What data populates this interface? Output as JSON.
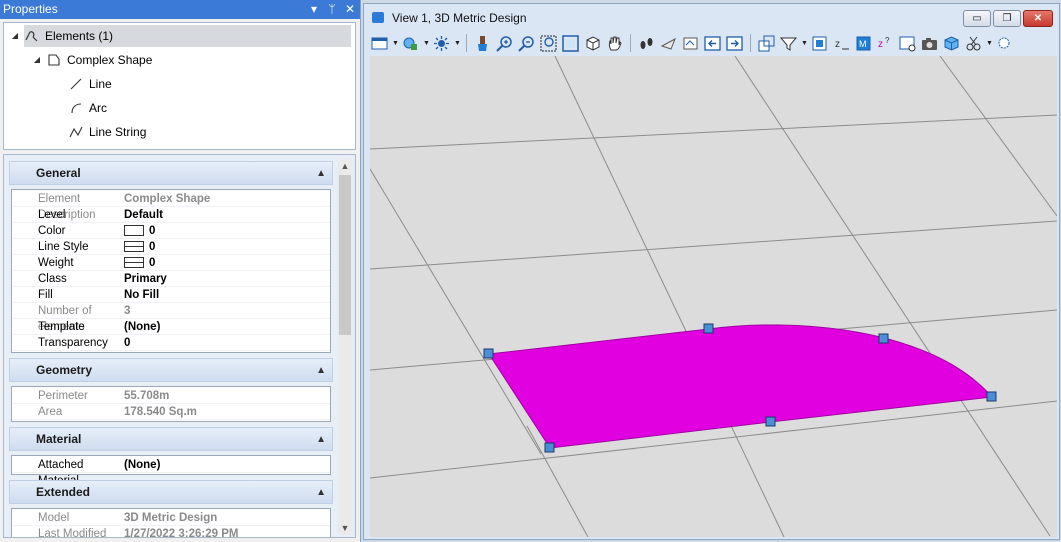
{
  "properties": {
    "title": "Properties",
    "title_buttons": [
      "▾",
      "ᛘ",
      "✕"
    ],
    "tree": [
      {
        "label": "Elements (1)",
        "icon": "elements-icon",
        "expander": "◢",
        "selected": true
      },
      {
        "label": "Complex Shape",
        "icon": "complex-shape-icon",
        "expander": "◢"
      },
      {
        "label": "Line",
        "icon": "line-icon"
      },
      {
        "label": "Arc",
        "icon": "arc-icon"
      },
      {
        "label": "Line String",
        "icon": "line-string-icon"
      }
    ],
    "sections": {
      "general": {
        "title": "General",
        "rows": [
          {
            "label": "Element Description",
            "value": "Complex Shape",
            "readonly": true
          },
          {
            "label": "Level",
            "value": "Default"
          },
          {
            "label": "Color",
            "value": "0",
            "swatch": "color"
          },
          {
            "label": "Line Style",
            "value": "0",
            "swatch": "lines"
          },
          {
            "label": "Weight",
            "value": "0",
            "swatch": "lines"
          },
          {
            "label": "Class",
            "value": "Primary"
          },
          {
            "label": "Fill",
            "value": "No Fill"
          },
          {
            "label": "Number of elements",
            "value": "3",
            "readonly": true
          },
          {
            "label": "Template",
            "value": "(None)"
          },
          {
            "label": "Transparency",
            "value": "0"
          }
        ]
      },
      "geometry": {
        "title": "Geometry",
        "rows": [
          {
            "label": "Perimeter",
            "value": "55.708m",
            "readonly": true
          },
          {
            "label": "Area",
            "value": "178.540 Sq.m",
            "readonly": true
          }
        ]
      },
      "material": {
        "title": "Material",
        "rows": [
          {
            "label": "Attached Material",
            "value": "(None)"
          }
        ]
      },
      "extended": {
        "title": "Extended",
        "rows": [
          {
            "label": "Model",
            "value": "3D Metric Design",
            "readonly": true
          },
          {
            "label": "Last Modified",
            "value": "1/27/2022 3:26:29 PM",
            "readonly": true
          }
        ]
      }
    }
  },
  "view": {
    "title": "View 1, 3D Metric Design",
    "window_buttons": {
      "minimize": "▭",
      "restore": "❐",
      "close": "✕"
    },
    "toolbar_icons": [
      "view-attributes-icon",
      "display-style-icon",
      "lights-icon",
      "update-view-icon",
      "zoom-in-icon",
      "zoom-out-icon",
      "window-area-icon",
      "fit-view-icon",
      "rotate-view-icon",
      "pan-view-icon",
      "walk-icon",
      "fly-icon",
      "view-previous-icon",
      "view-next-icon",
      "copy-view-icon",
      "clip-volume-icon",
      "clip-mask-icon",
      "change-view-perspective-icon",
      "toggle-clip-icon",
      "camera-icon",
      "view-cube-icon",
      "fence-clip-icon",
      "element-selection-icon",
      "save-view-icon",
      "more-icon"
    ],
    "shape_fill": "#e000e0",
    "grid_color": "#8c8c8c"
  }
}
